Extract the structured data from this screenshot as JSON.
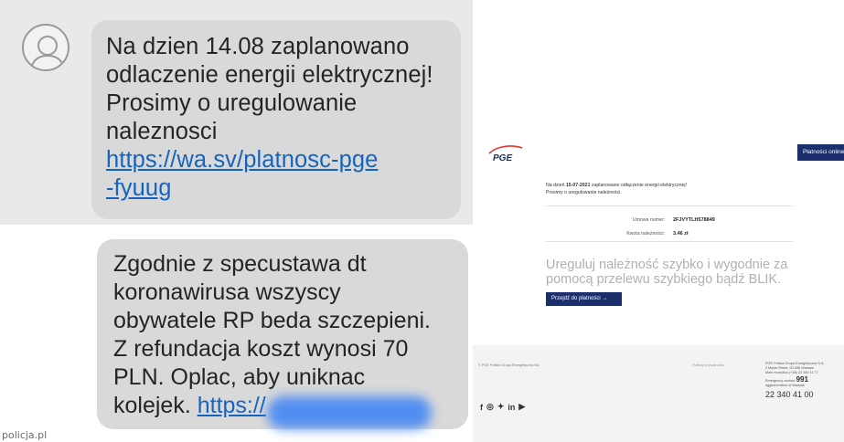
{
  "sms1": {
    "lines": [
      "Na dzien 14.08 zaplanowano",
      "odlaczenie energii elektrycznej!",
      "Prosimy o uregulowanie",
      "naleznosci"
    ],
    "link_line1": "https://wa.sv/platnosc-pge",
    "link_line2": "-fyuug"
  },
  "sms2": {
    "lines": [
      "Zgodnie z specustawa dt",
      "koronawirusa wszyscy",
      "obywatele RP beda szczepieni.",
      "Z refundacja koszt wynosi 70",
      "PLN. Oplac, aby uniknac"
    ],
    "last_text": "kolejek. ",
    "link": "https://"
  },
  "watermark": "policja.pl",
  "pge_page": {
    "logo": "PGE",
    "pay_online_button": "Płatności online",
    "message_prefix": "Na dzień ",
    "message_date": "15-07-2021",
    "message_rest": " zaplanowano odłączenie energii elektrycznej!",
    "message_line2": "Prosimy o uregulowanie należności.",
    "contract_label": "Umowa numer:",
    "contract_value": "2FJVYTLH578849",
    "amount_label": "Kwota należności:",
    "amount_value": "3.46 zł",
    "headline": "Ureguluj należność szybko i wygodnie za pomocą przelewu szybkiego bądź BLIK.",
    "go_button": "Przejdź do płatności  →",
    "footer": {
      "company": "© PGE Polska Grupa Energetyczna SA",
      "policy": "Polityka prywatności",
      "address": [
        "PGE Polska Grupa Energetyczna S.A.",
        "2 Mysia Street, 00-496 Warsaw",
        "Main reception (+48) 22 340 11 77"
      ],
      "emergency_label": "Emergency contact",
      "emergency_number": "991",
      "emergency_note": "agglomeration of Warsaw",
      "phone": "22 340 41 00"
    },
    "social_icons": [
      "facebook-icon",
      "instagram-icon",
      "twitter-icon",
      "linkedin-icon",
      "youtube-icon"
    ],
    "colors": {
      "navy": "#1a2f6b",
      "logo_red": "#e4322b"
    }
  }
}
